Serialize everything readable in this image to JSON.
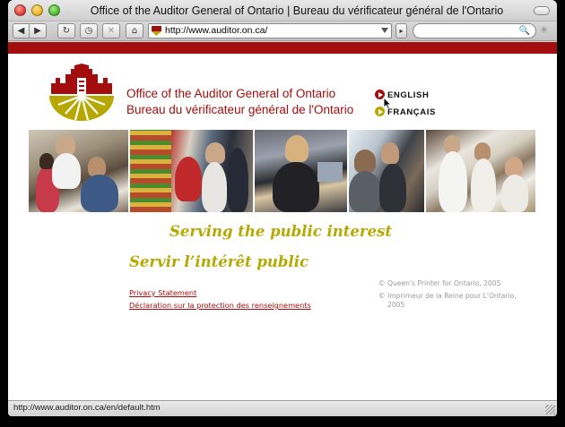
{
  "window": {
    "title": "Office of the Auditor General of Ontario | Bureau du vérificateur général de l'Ontario"
  },
  "toolbar": {
    "back_icon": "◀",
    "forward_icon": "▶",
    "reload_icon": "↻",
    "history_icon": "◷",
    "stop_icon": "✕",
    "home_icon": "⌂",
    "rss_icon": "▸",
    "address": "http://www.auditor.on.ca/",
    "search_value": "",
    "search_icon": "🔍",
    "spinner_icon": "✳"
  },
  "page": {
    "office_en": "Office of the Auditor General of Ontario",
    "office_fr": "Bureau du vérificateur général de l'Ontario",
    "lang_en": "ENGLISH",
    "lang_fr": "FRANÇAIS",
    "slogan_en": "Serving the public interest",
    "slogan_fr": "Servir l’intérêt public",
    "privacy_en": "Privacy Statement",
    "privacy_fr": "Déclaration sur la protection des renseignements",
    "copyright_en": "© Queen's Printer for Ontario, 2005",
    "copyright_fr_line1": "© Imprimeur de la Reine pour L'Ontario,",
    "copyright_fr_line2": "2005"
  },
  "status": {
    "text": "http://www.auditor.on.ca/en/default.htm"
  },
  "colors": {
    "brand_red": "#a30d0d",
    "brand_gold": "#b6a800"
  },
  "icons": {
    "crest": "ontario-crest-icon",
    "cursor": "arrow-cursor-icon"
  }
}
